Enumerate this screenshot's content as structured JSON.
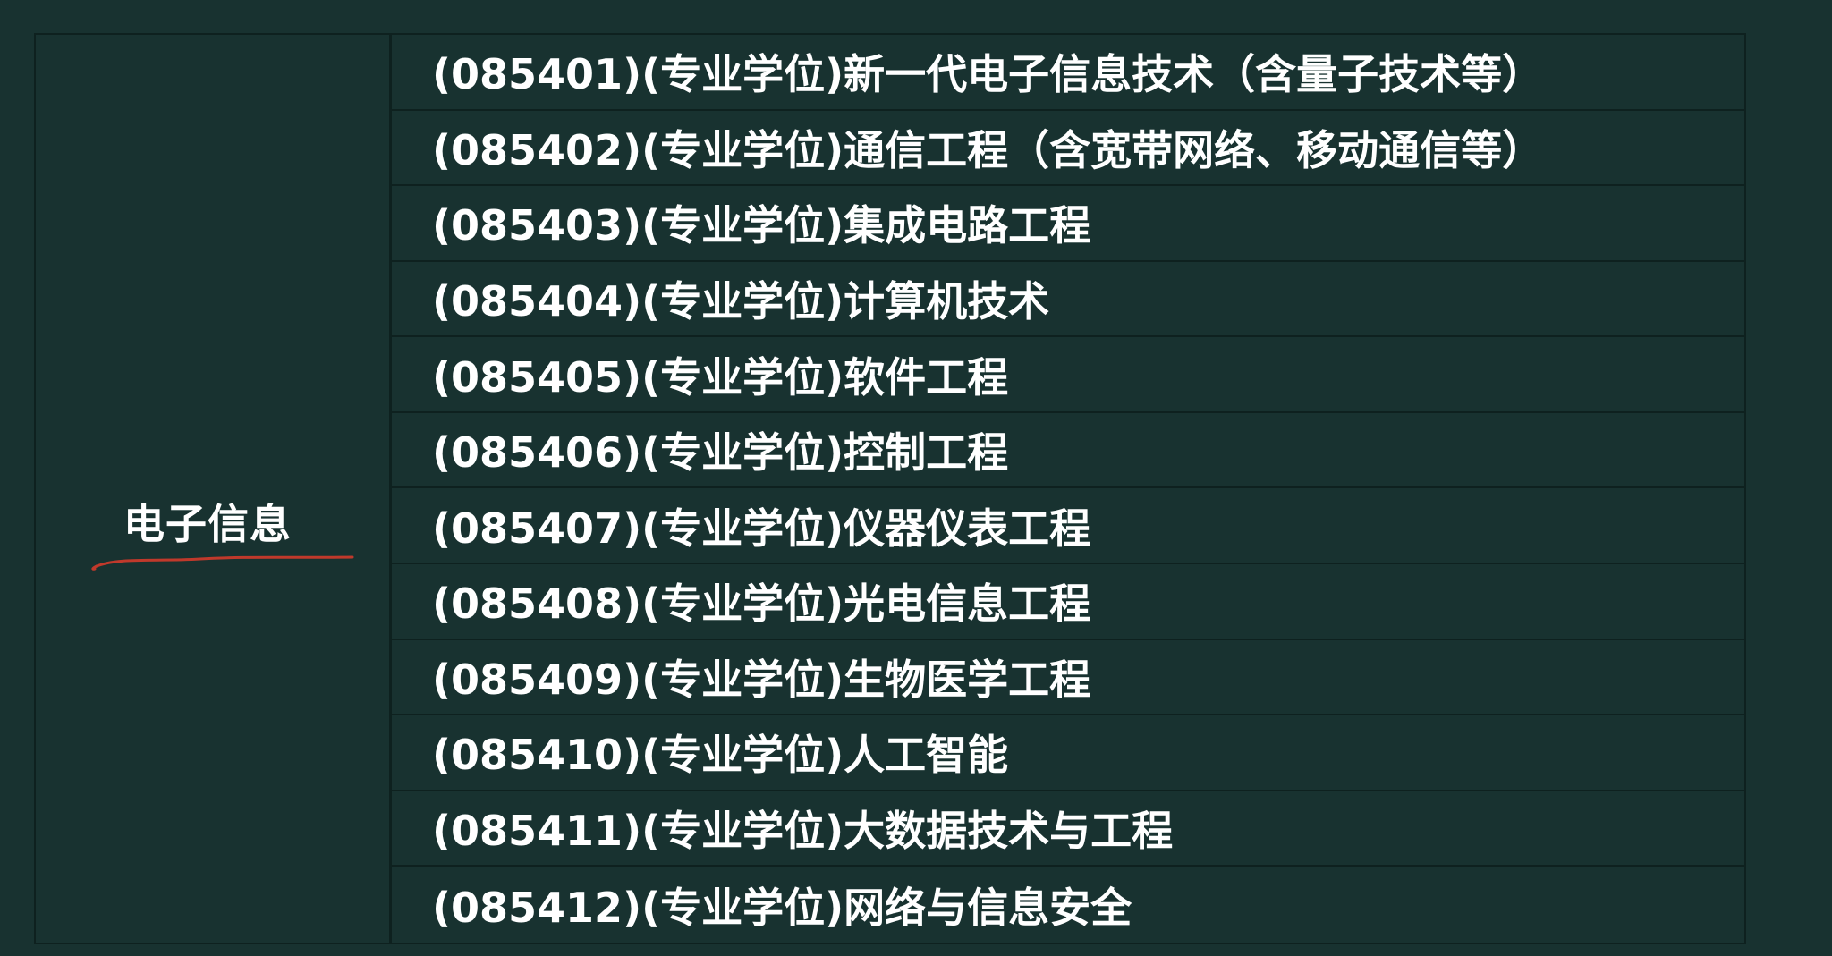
{
  "category": {
    "label": "电子信息",
    "underline_color": "#c0392b"
  },
  "programs": [
    "(085401)(专业学位)新一代电子信息技术（含量子技术等）",
    "(085402)(专业学位)通信工程（含宽带网络、移动通信等）",
    "(085403)(专业学位)集成电路工程",
    "(085404)(专业学位)计算机技术",
    "(085405)(专业学位)软件工程",
    "(085406)(专业学位)控制工程",
    "(085407)(专业学位)仪器仪表工程",
    "(085408)(专业学位)光电信息工程",
    "(085409)(专业学位)生物医学工程",
    "(085410)(专业学位)人工智能",
    "(085411)(专业学位)大数据技术与工程",
    "(085412)(专业学位)网络与信息安全"
  ],
  "colors": {
    "background": "#183230",
    "grid_lines": "#0e211f",
    "text": "#ffffff"
  }
}
